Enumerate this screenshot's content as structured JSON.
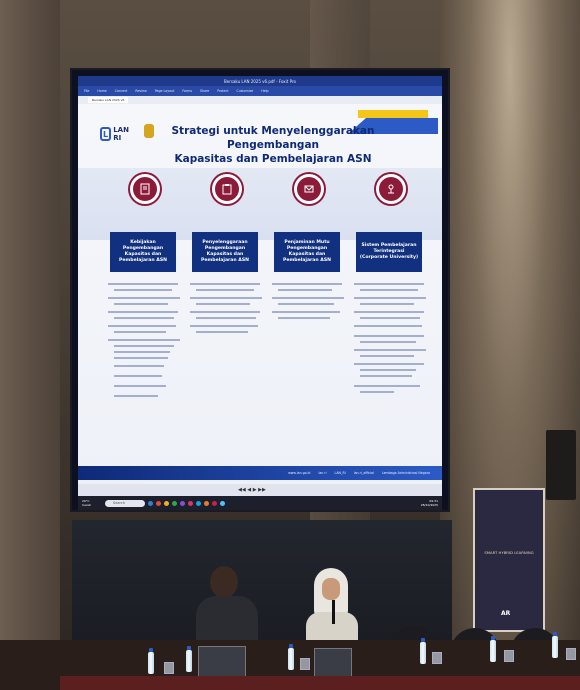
{
  "window": {
    "title": "Bersaku LAN 2025 v6.pdf - Foxit Pro",
    "menu": [
      "File",
      "Home",
      "Convert",
      "Review",
      "Page Layout",
      "Forms",
      "Share",
      "Protect",
      "Customize",
      "Help"
    ],
    "doc_tab": "Bersaku LAN 2025 v6"
  },
  "slide": {
    "logo_text": "LAN RI",
    "title_line1": "Strategi untuk Menyelenggarakan Pengembangan",
    "title_line2": "Kapasitas dan Pembelajaran ASN",
    "pillars": [
      {
        "heading": "Kebijakan Pengembangan Kapasitas dan Pembelajaran ASN",
        "icon": "document-icon"
      },
      {
        "heading": "Penyelenggaraan Pengembangan Kapasitas dan Pembelajaran ASN",
        "icon": "clipboard-icon"
      },
      {
        "heading": "Penjaminan Mutu Pengembangan Kapasitas dan Pembelajaran ASN",
        "icon": "badge-icon"
      },
      {
        "heading": "Sistem Pembelajaran Terintegrasi (Corporate University)",
        "icon": "network-icon"
      }
    ],
    "footer_links": [
      "www.lan.go.id",
      "lan.ri",
      "LAN_RI",
      "lan.ri_official",
      "Lembaga Administrasi Negara"
    ]
  },
  "taskbar": {
    "weather_temp": "29°C",
    "weather_desc": "Cerah",
    "search_placeholder": "Search",
    "time": "09:31",
    "date": "28/10/2025"
  },
  "banner": {
    "text": "SMART HYBRID LEARNING",
    "logo": "AR"
  }
}
